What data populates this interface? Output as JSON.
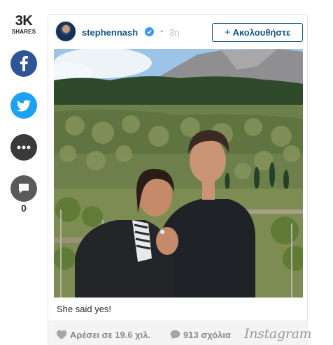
{
  "share_rail": {
    "count": "3K",
    "label": "SHARES",
    "comment_count": "0"
  },
  "post": {
    "username": "stephennash",
    "time": "3η",
    "follow_label": "Ακολουθήστε",
    "caption": "She said yes!",
    "likes": "Αρέσει σε 19.6 χιλ.",
    "comments": "913 σχόλια",
    "brand": "Instagram"
  },
  "colors": {
    "facebook": "#2f5596",
    "twitter": "#1da1f2",
    "link": "#125688",
    "verified": "#3897f0"
  },
  "icons": [
    "facebook-icon",
    "twitter-icon",
    "more-icon",
    "comment-icon",
    "verified-icon",
    "heart-icon",
    "comment-bubble-icon"
  ]
}
